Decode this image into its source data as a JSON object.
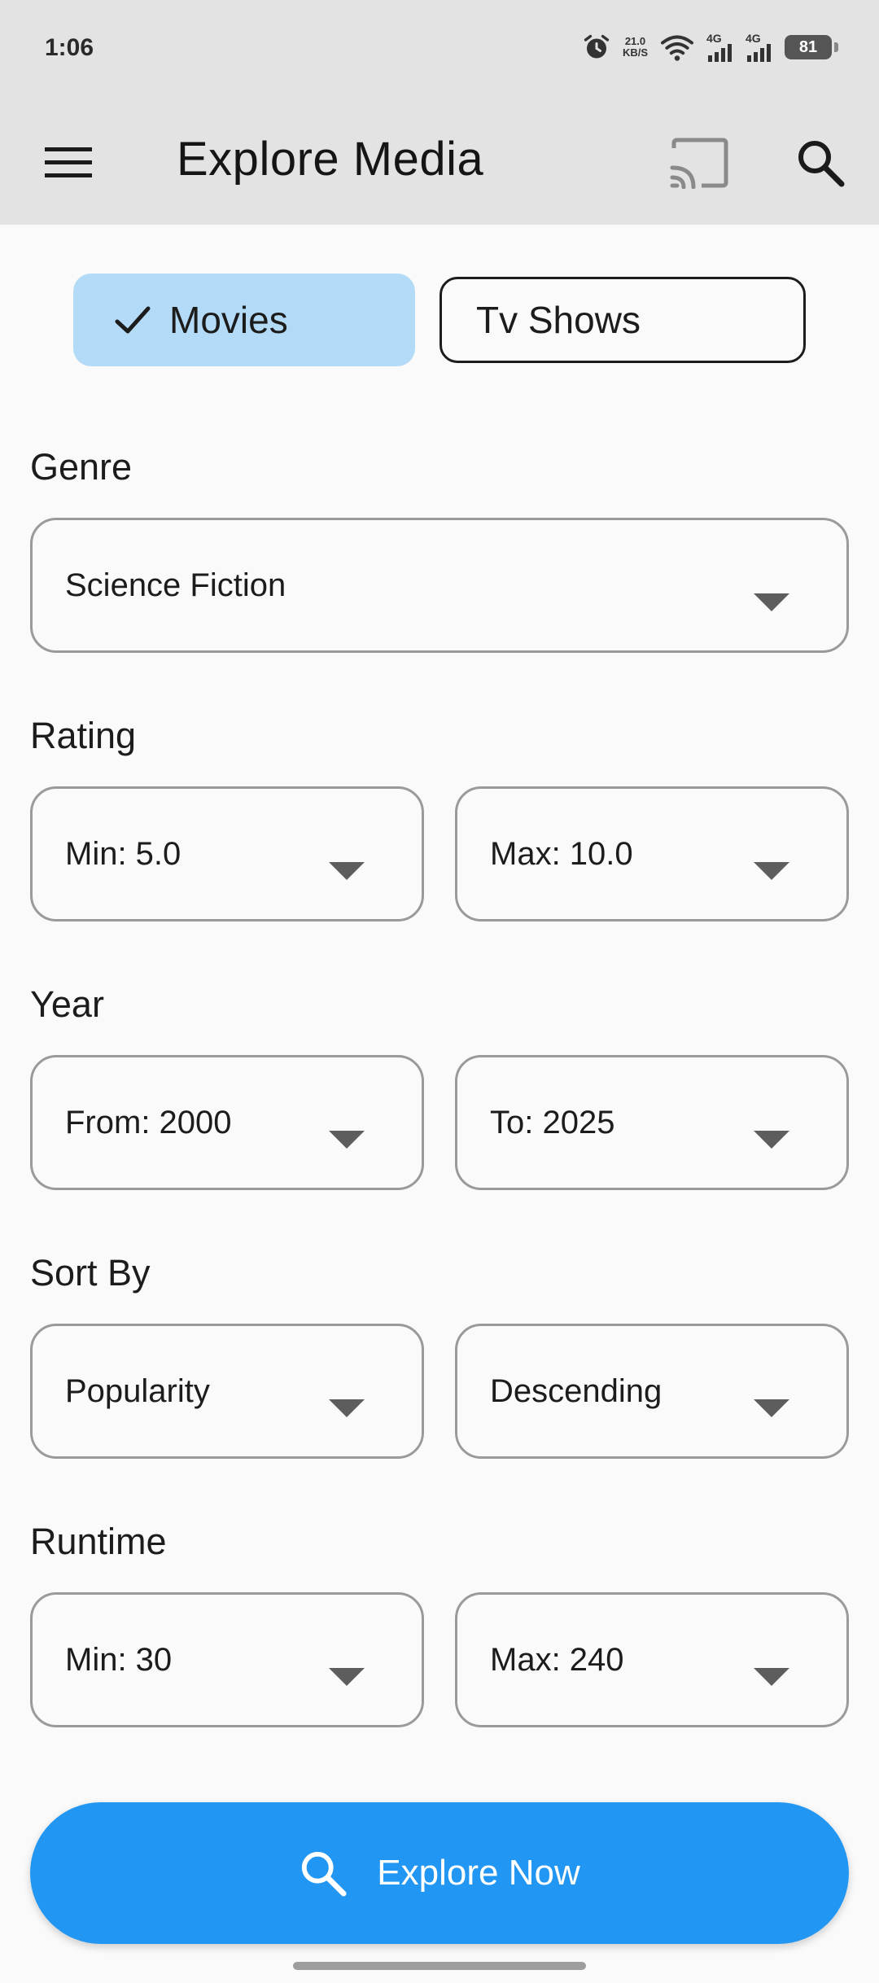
{
  "status_bar": {
    "time": "1:06",
    "net_speed_value": "21.0",
    "net_speed_unit": "KB/S",
    "signal1": "4G",
    "signal2": "4G",
    "battery": "81"
  },
  "app_bar": {
    "title": "Explore Media"
  },
  "media_toggle": {
    "movies_label": "Movies",
    "tv_label": "Tv Shows",
    "selected": "Movies"
  },
  "filters": {
    "genre": {
      "label": "Genre",
      "value": "Science Fiction"
    },
    "rating": {
      "label": "Rating",
      "min": "Min: 5.0",
      "max": "Max: 10.0"
    },
    "year": {
      "label": "Year",
      "from": "From: 2000",
      "to": "To: 2025"
    },
    "sort": {
      "label": "Sort By",
      "field": "Popularity",
      "order": "Descending"
    },
    "runtime": {
      "label": "Runtime",
      "min": "Min: 30",
      "max": "Max: 240"
    }
  },
  "actions": {
    "explore_label": "Explore Now"
  },
  "colors": {
    "accent": "#2196f3",
    "selected_chip": "#b3dbf7",
    "app_bar": "#e3e3e3",
    "background": "#fafafa"
  },
  "icons": {
    "menu": "hamburger-menu-icon",
    "cast": "cast-icon",
    "search": "search-icon",
    "check": "check-icon",
    "dropdown": "dropdown-caret-icon"
  }
}
